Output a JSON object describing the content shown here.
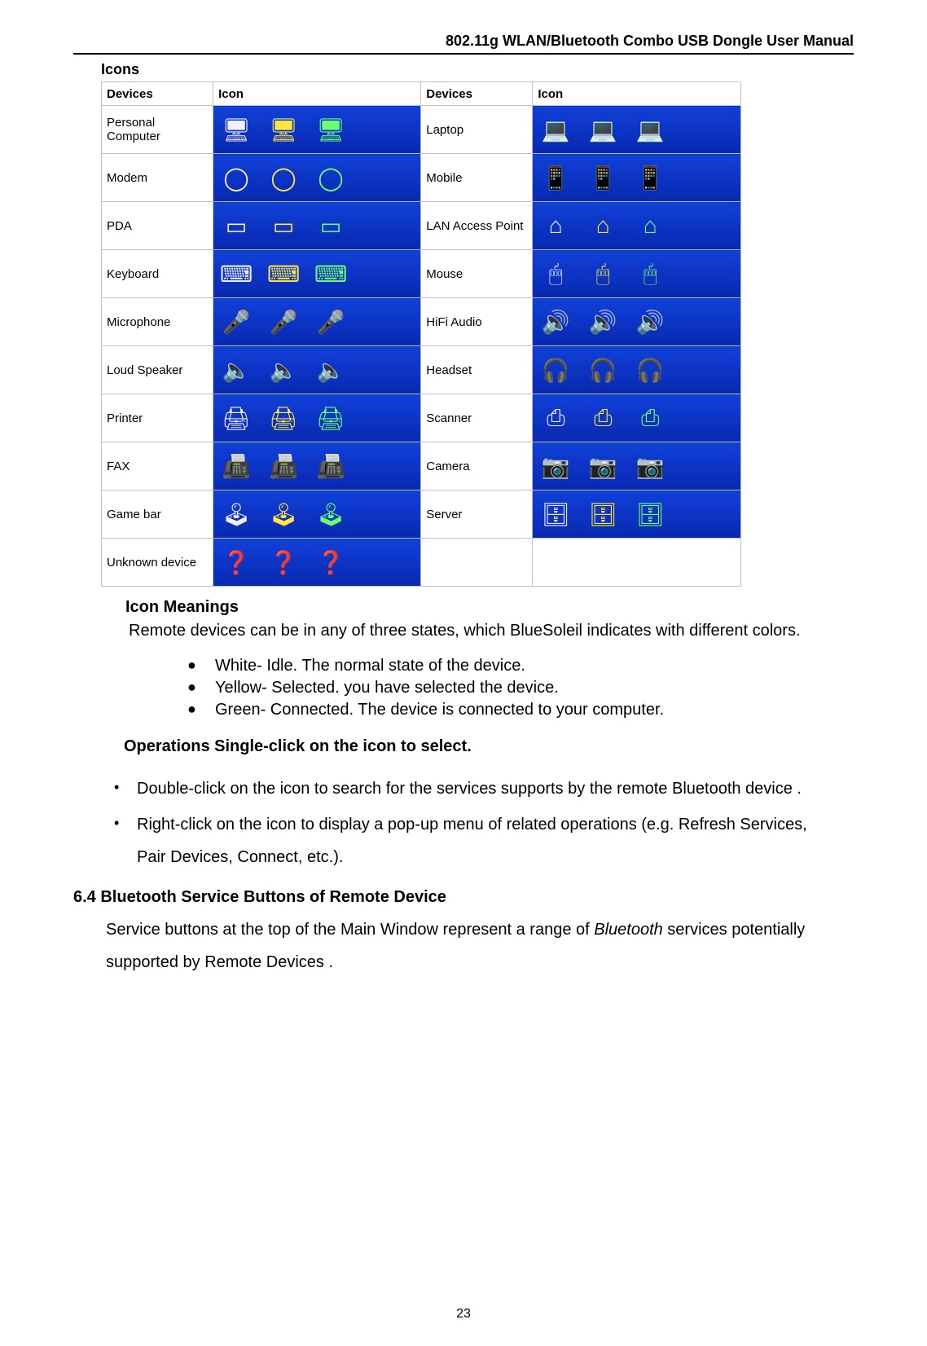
{
  "header": {
    "title": "802.11g WLAN/Bluetooth Combo USB Dongle User Manual"
  },
  "icons_section": {
    "title": "Icons",
    "col_devices": "Devices",
    "col_icon": "Icon",
    "rows": [
      {
        "left": "Personal Computer",
        "left_icon": "🖥",
        "right": "Laptop",
        "right_icon": "💻"
      },
      {
        "left": "Modem",
        "left_icon": "◯",
        "right": "Mobile",
        "right_icon": "📱"
      },
      {
        "left": "PDA",
        "left_icon": "▭",
        "right": "LAN Access Point",
        "right_icon": "⌂"
      },
      {
        "left": "Keyboard",
        "left_icon": "⌨",
        "right": "Mouse",
        "right_icon": "🖱"
      },
      {
        "left": "Microphone",
        "left_icon": "🎤",
        "right": "HiFi Audio",
        "right_icon": "🔊"
      },
      {
        "left": "Loud Speaker",
        "left_icon": "🔈",
        "right": "Headset",
        "right_icon": "🎧"
      },
      {
        "left": "Printer",
        "left_icon": "🖨",
        "right": "Scanner",
        "right_icon": "⎙"
      },
      {
        "left": "FAX",
        "left_icon": "📠",
        "right": "Camera",
        "right_icon": "📷"
      },
      {
        "left": "Game bar",
        "left_icon": "🕹",
        "right": "Server",
        "right_icon": "🗄"
      },
      {
        "left": "Unknown device",
        "left_icon": "❓",
        "right": "",
        "right_icon": ""
      }
    ]
  },
  "icon_meanings": {
    "heading": "Icon Meanings",
    "intro": "Remote devices can be in any of three states, which BlueSoleil indicates with different colors.",
    "items": [
      "White- Idle. The normal state of the device.",
      "Yellow- Selected. you have selected the device.",
      "Green- Connected. The device is connected to your computer."
    ]
  },
  "operations": {
    "heading": "Operations Single-click on the icon to select.",
    "items": [
      "Double-click on the icon to search   for the services supports by the remote Bluetooth device .",
      "Right-click on the icon to display a pop-up menu of related operations (e.g. Refresh Services, Pair Devices, Connect, etc.)."
    ]
  },
  "section64": {
    "heading": "6.4 Bluetooth Service Buttons of Remote Device",
    "body_pre": "Service buttons at the top of the Main Window represent a range of ",
    "body_em": "Bluetooth",
    "body_post": " services potentially supported by Remote Devices ."
  },
  "pagenum": "23"
}
